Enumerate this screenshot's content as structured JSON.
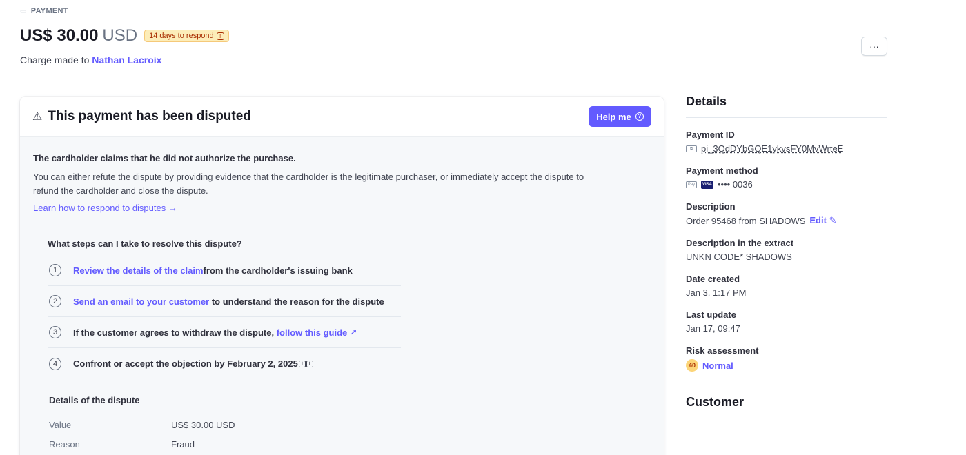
{
  "header": {
    "crumb": "PAYMENT",
    "amount": "US$ 30.00",
    "currency": "USD",
    "badge": "14 days to respond",
    "charge_prefix": "Charge made to",
    "customer_name": "Nathan Lacroix",
    "more_label": "···"
  },
  "dispute": {
    "title": "This payment has been disputed",
    "help_label": "Help me",
    "claim": "The cardholder claims that he did not authorize the purchase.",
    "description": "You can either refute the dispute by providing evidence that the cardholder is the legitimate purchaser, or immediately accept the dispute to refund the cardholder and close the dispute.",
    "learn_link": "Learn how to respond to disputes →",
    "steps_title": "What steps can I take to resolve this dispute?",
    "steps": [
      {
        "num": "1",
        "link": "Review the details of the claim",
        "text": "from the cardholder's issuing bank"
      },
      {
        "num": "2",
        "link": "Send an email to your customer",
        "text": " to understand the reason for the dispute"
      },
      {
        "num": "3",
        "text": "If the customer agrees to withdraw the dispute, ",
        "link": "follow this guide"
      },
      {
        "num": "4",
        "text": "Confront or accept the objection by February 2, 2025"
      }
    ],
    "details_title": "Details of the dispute",
    "details": [
      {
        "label": "Value",
        "value": "US$ 30.00 USD"
      },
      {
        "label": "Reason",
        "value": "Fraud"
      }
    ]
  },
  "side": {
    "details_title": "Details",
    "payment_id_label": "Payment ID",
    "payment_id": "pi_3QdDYbGQE1ykvsFY0MvWrteE",
    "payment_method_label": "Payment method",
    "card_last4": "•••• 0036",
    "description_label": "Description",
    "description": "Order 95468 from SHADOWS",
    "edit_label": "Edit",
    "extract_label": "Description in the extract",
    "extract": "UNKN CODE* SHADOWS",
    "date_created_label": "Date created",
    "date_created": "Jan 3, 1:17 PM",
    "last_update_label": "Last update",
    "last_update": "Jan 17, 09:47",
    "risk_label": "Risk assessment",
    "risk_score": "40",
    "risk_level": "Normal",
    "customer_title": "Customer"
  },
  "colors": {
    "accent": "#635bff",
    "badge_bg": "#fcedb9",
    "badge_text": "#a82c00"
  }
}
